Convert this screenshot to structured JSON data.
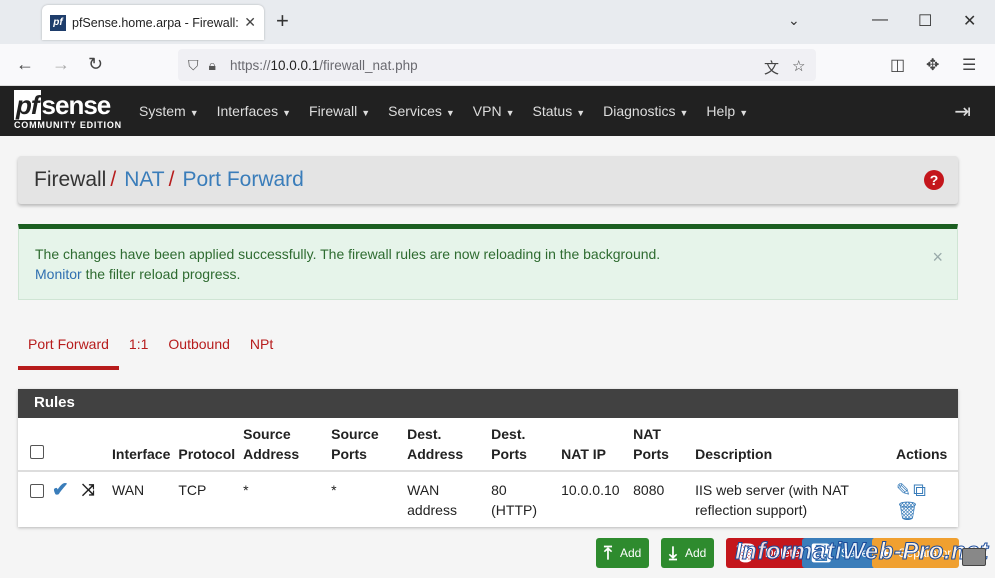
{
  "browser": {
    "tab_title": "pfSense.home.arpa - Firewall: NAT: Port Forward",
    "tab_favicon": "pf",
    "url_scheme": "https://",
    "url_host": "10.0.0.1",
    "url_path": "/firewall_nat.php"
  },
  "header": {
    "logo_main": "sense",
    "logo_pf": "pf",
    "logo_sub": "COMMUNITY EDITION",
    "menu": [
      "System",
      "Interfaces",
      "Firewall",
      "Services",
      "VPN",
      "Status",
      "Diagnostics",
      "Help"
    ]
  },
  "breadcrumb": {
    "first": "Firewall",
    "second": "NAT",
    "third": "Port Forward",
    "sep": "/"
  },
  "alert": {
    "line1": "The changes have been applied successfully. The firewall rules are now reloading in the background.",
    "link": "Monitor",
    "line2": " the filter reload progress."
  },
  "tabs": [
    "Port Forward",
    "1:1",
    "Outbound",
    "NPt"
  ],
  "panel": {
    "title": "Rules",
    "columns": {
      "interface": "Interface",
      "protocol": "Protocol",
      "src_addr": [
        "Source",
        "Address"
      ],
      "src_ports": [
        "Source",
        "Ports"
      ],
      "dst_addr": [
        "Dest.",
        "Address"
      ],
      "dst_ports": [
        "Dest.",
        "Ports"
      ],
      "nat_ip": "NAT IP",
      "nat_ports": [
        "NAT",
        "Ports"
      ],
      "description": "Description",
      "actions": "Actions"
    },
    "rows": [
      {
        "interface": "WAN",
        "protocol": "TCP",
        "src_addr": "*",
        "src_ports": "*",
        "dst_addr": [
          "WAN",
          "address"
        ],
        "dst_ports": [
          "80",
          "(HTTP)"
        ],
        "nat_ip": "10.0.0.10",
        "nat_ports": "8080",
        "description": [
          "IIS web server (with NAT",
          "reflection support)"
        ]
      }
    ]
  },
  "buttons": {
    "add_top": "Add",
    "add_bottom": "Add",
    "delete": "Delete",
    "save": "Save",
    "separator": "Separator"
  },
  "watermark": "InformatiWeb-Pro.net",
  "colors": {
    "accent_red": "#b71c1c",
    "link_blue": "#3a7dba",
    "header_bg": "#212121",
    "success_green": "#1b5e20"
  }
}
